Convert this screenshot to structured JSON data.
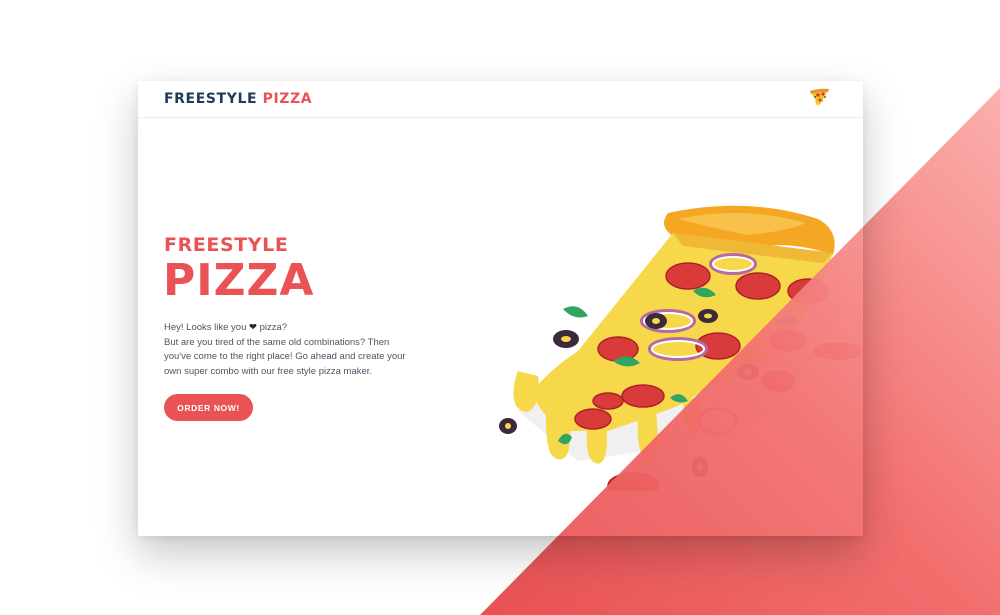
{
  "colors": {
    "accent": "#e95355",
    "navy": "#1f3a5a",
    "text": "#4b5563"
  },
  "nav": {
    "logo_word1": "FREESTYLE",
    "logo_word2": "PIZZA",
    "icon": "pizza-slice-icon"
  },
  "hero": {
    "title_small": "FREESTYLE",
    "title_big": "PIZZA",
    "line1_before": "Hey! Looks like you",
    "heart": "❤",
    "line1_after": "pizza?",
    "line2": "But are you tired of the same old combinations? Then you've come to the right place! Go ahead and create your own super combo with our free style pizza maker.",
    "cta_label": "ORDER NOW!"
  }
}
